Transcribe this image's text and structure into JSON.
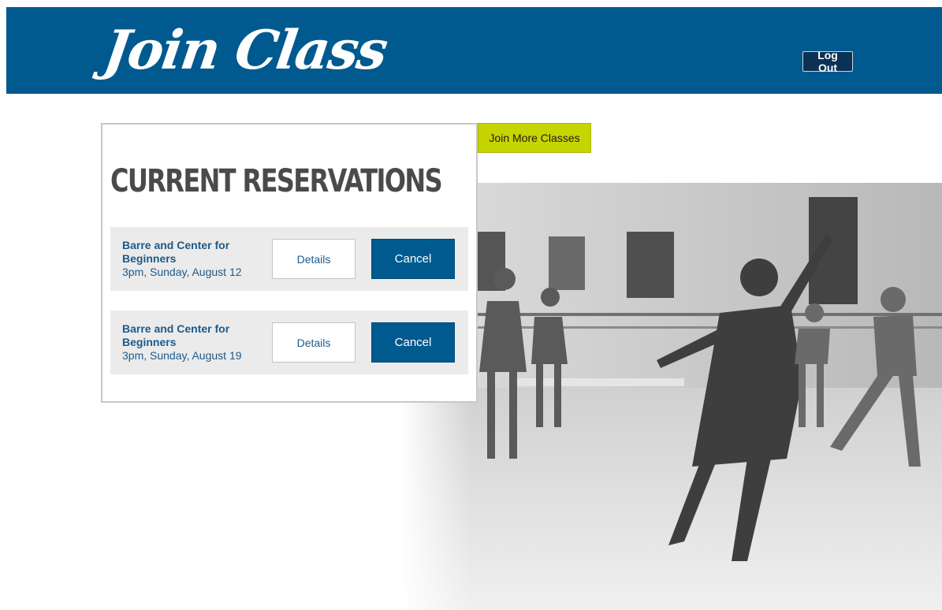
{
  "header": {
    "logo_text": "Join Class",
    "logout_label": "Log Out",
    "brand_color": "#005a8f"
  },
  "actions": {
    "join_more_label": "Join More Classes",
    "join_more_color": "#c6d400"
  },
  "reservations": {
    "title": "CURRENT RESERVATIONS",
    "items": [
      {
        "name": "Barre and Center for Beginners",
        "time": "3pm, Sunday, August 12",
        "details_label": "Details",
        "cancel_label": "Cancel"
      },
      {
        "name": "Barre and Center for Beginners",
        "time": "3pm, Sunday, August 19",
        "details_label": "Details",
        "cancel_label": "Cancel"
      }
    ]
  },
  "background": {
    "image_subject": "dance-class-photo"
  }
}
